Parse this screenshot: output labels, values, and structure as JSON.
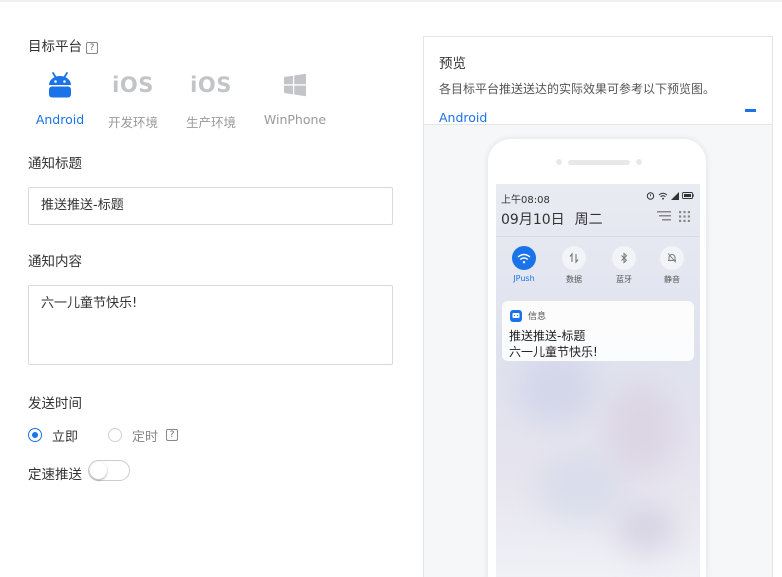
{
  "form": {
    "target_platform_label": "目标平台",
    "help_glyph": "?",
    "platforms": [
      {
        "name": "Android",
        "icon": "android-icon",
        "active": true
      },
      {
        "name": "开发环境",
        "icon": "ios-icon",
        "icon_text": "iOS",
        "active": false
      },
      {
        "name": "生产环境",
        "icon": "ios-icon",
        "icon_text": "iOS",
        "active": false
      },
      {
        "name": "WinPhone",
        "icon": "windows-icon",
        "active": false
      }
    ],
    "title_label": "通知标题",
    "title_value": "推送推送-标题",
    "content_label": "通知内容",
    "content_value": "六一儿童节快乐!",
    "send_time_label": "发送时间",
    "send_options": [
      {
        "label": "立即",
        "selected": true
      },
      {
        "label": "定时",
        "selected": false
      }
    ],
    "rate_push_label": "定速推送",
    "rate_push_on": false
  },
  "preview": {
    "title": "预览",
    "description": "各目标平台推送送达的实际效果可参考以下预览图。",
    "tab": "Android",
    "phone": {
      "status_time": "上午08:08",
      "date": "09月10日",
      "weekday": "周二",
      "quick_settings": [
        {
          "label": "JPush",
          "icon": "wifi-icon",
          "active": true
        },
        {
          "label": "数据",
          "icon": "data-icon",
          "active": false
        },
        {
          "label": "蓝牙",
          "icon": "bluetooth-icon",
          "active": false
        },
        {
          "label": "静音",
          "icon": "bell-icon",
          "active": false
        }
      ],
      "notification": {
        "app_name": "信息",
        "title": "推送推送-标题",
        "body": "六一儿童节快乐!"
      }
    }
  },
  "colors": {
    "accent": "#1a73e8",
    "android_icon": "#1a73e8",
    "inactive_icon": "#c2c4c8"
  }
}
